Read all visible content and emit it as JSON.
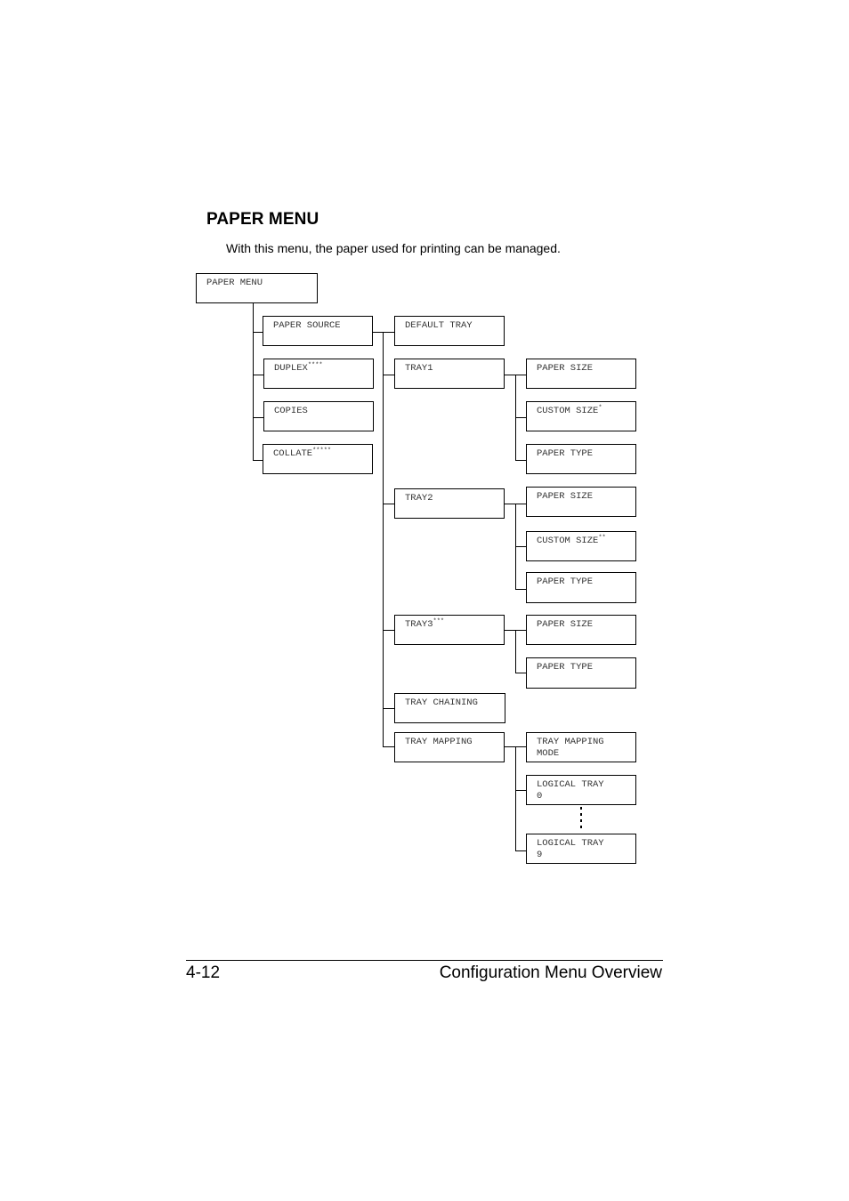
{
  "section": {
    "heading": "PAPER MENU",
    "intro": "With this menu, the paper used for printing can be managed."
  },
  "tree": {
    "root": {
      "label": "PAPER MENU"
    },
    "level1": [
      {
        "label": "PAPER SOURCE",
        "note": ""
      },
      {
        "label": "DUPLEX",
        "note": "****"
      },
      {
        "label": "COPIES",
        "note": ""
      },
      {
        "label": "COLLATE",
        "note": "*****"
      }
    ],
    "paper_source_children": [
      {
        "label": "DEFAULT TRAY",
        "note": ""
      },
      {
        "label": "TRAY1",
        "note": ""
      },
      {
        "label": "TRAY2",
        "note": ""
      },
      {
        "label": "TRAY3",
        "note": "***"
      },
      {
        "label": "TRAY CHAINING",
        "note": ""
      },
      {
        "label": "TRAY MAPPING",
        "note": ""
      }
    ],
    "tray1_children": [
      {
        "label": "PAPER SIZE",
        "note": ""
      },
      {
        "label": "CUSTOM SIZE",
        "note": "*"
      },
      {
        "label": "PAPER TYPE",
        "note": ""
      }
    ],
    "tray2_children": [
      {
        "label": "PAPER SIZE",
        "note": ""
      },
      {
        "label": "CUSTOM SIZE",
        "note": "**"
      },
      {
        "label": "PAPER TYPE",
        "note": ""
      }
    ],
    "tray3_children": [
      {
        "label": "PAPER SIZE",
        "note": ""
      },
      {
        "label": "PAPER TYPE",
        "note": ""
      }
    ],
    "tray_mapping_children": [
      {
        "label": "TRAY MAPPING\nMODE",
        "note": ""
      },
      {
        "label": "LOGICAL TRAY\n0",
        "note": ""
      },
      {
        "label": "LOGICAL TRAY\n9",
        "note": ""
      }
    ]
  },
  "footer": {
    "page_number": "4-12",
    "chapter_title": "Configuration Menu Overview"
  }
}
